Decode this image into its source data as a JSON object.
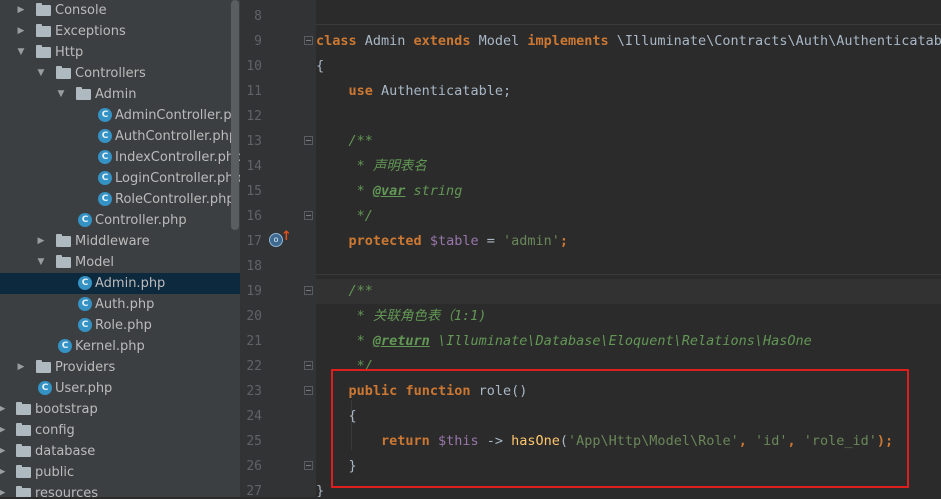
{
  "tree": {
    "items": [
      {
        "label": "Console",
        "kind": "folder",
        "expanded": false
      },
      {
        "label": "Exceptions",
        "kind": "folder",
        "expanded": false
      },
      {
        "label": "Http",
        "kind": "folder",
        "expanded": true
      },
      {
        "label": "Controllers",
        "kind": "folder",
        "expanded": true
      },
      {
        "label": "Admin",
        "kind": "folder",
        "expanded": true
      },
      {
        "label": "AdminController.php",
        "kind": "class"
      },
      {
        "label": "AuthController.php",
        "kind": "class"
      },
      {
        "label": "IndexController.php",
        "kind": "class"
      },
      {
        "label": "LoginController.php",
        "kind": "class"
      },
      {
        "label": "RoleController.php",
        "kind": "class"
      },
      {
        "label": "Controller.php",
        "kind": "class"
      },
      {
        "label": "Middleware",
        "kind": "folder",
        "expanded": false
      },
      {
        "label": "Model",
        "kind": "folder",
        "expanded": true
      },
      {
        "label": "Admin.php",
        "kind": "class",
        "selected": true
      },
      {
        "label": "Auth.php",
        "kind": "class"
      },
      {
        "label": "Role.php",
        "kind": "class"
      },
      {
        "label": "Kernel.php",
        "kind": "class"
      },
      {
        "label": "Providers",
        "kind": "folder",
        "expanded": false
      },
      {
        "label": "User.php",
        "kind": "class"
      },
      {
        "label": "bootstrap",
        "kind": "folder",
        "expanded": false
      },
      {
        "label": "config",
        "kind": "folder",
        "expanded": false
      },
      {
        "label": "database",
        "kind": "folder",
        "expanded": false
      },
      {
        "label": "public",
        "kind": "folder",
        "expanded": false
      },
      {
        "label": "resources",
        "kind": "folder",
        "expanded": false
      }
    ],
    "class_icon_letter": "C"
  },
  "editor": {
    "line_numbers": [
      "8",
      "9",
      "10",
      "11",
      "12",
      "13",
      "14",
      "15",
      "16",
      "17",
      "18",
      "19",
      "20",
      "21",
      "22",
      "23",
      "24",
      "25",
      "26",
      "27"
    ],
    "lines": {
      "l9": [
        "class",
        " Admin ",
        "extends",
        " Model ",
        "implements",
        " \\Illuminate\\Contracts\\Auth\\Authenticatable"
      ],
      "l10": "{",
      "l11": [
        "use",
        " Authenticatable;"
      ],
      "l13": "/**",
      "l14": " * 声明表名",
      "l15": [
        " * ",
        "@var",
        " string"
      ],
      "l16": " */",
      "l17": [
        "protected",
        " ",
        "$table",
        " = ",
        "'admin'",
        ";"
      ],
      "l19": "/**",
      "l20": " * 关联角色表（1:1)",
      "l21": [
        " * ",
        "@return",
        " \\Illuminate\\Database\\Eloquent\\Relations\\HasOne"
      ],
      "l22": " */",
      "l23": [
        "public",
        " ",
        "function",
        " ",
        "role",
        "()"
      ],
      "l24": "{",
      "l25": [
        "return",
        " ",
        "$this",
        " -> ",
        "hasOne",
        "(",
        "'App\\Http\\Model\\Role'",
        ", ",
        "'id'",
        ", ",
        "'role_id'",
        ");"
      ],
      "l26": "}",
      "l27": "}"
    }
  },
  "colors": {
    "keyword": "#cc7832",
    "comment": "#629755",
    "string": "#6a8759",
    "variable": "#9876aa",
    "function": "#ffc66d",
    "highlight_box": "#e01e1e"
  },
  "gutter_icons": {
    "implements": "implements-icon",
    "override": "up-arrow-icon"
  }
}
